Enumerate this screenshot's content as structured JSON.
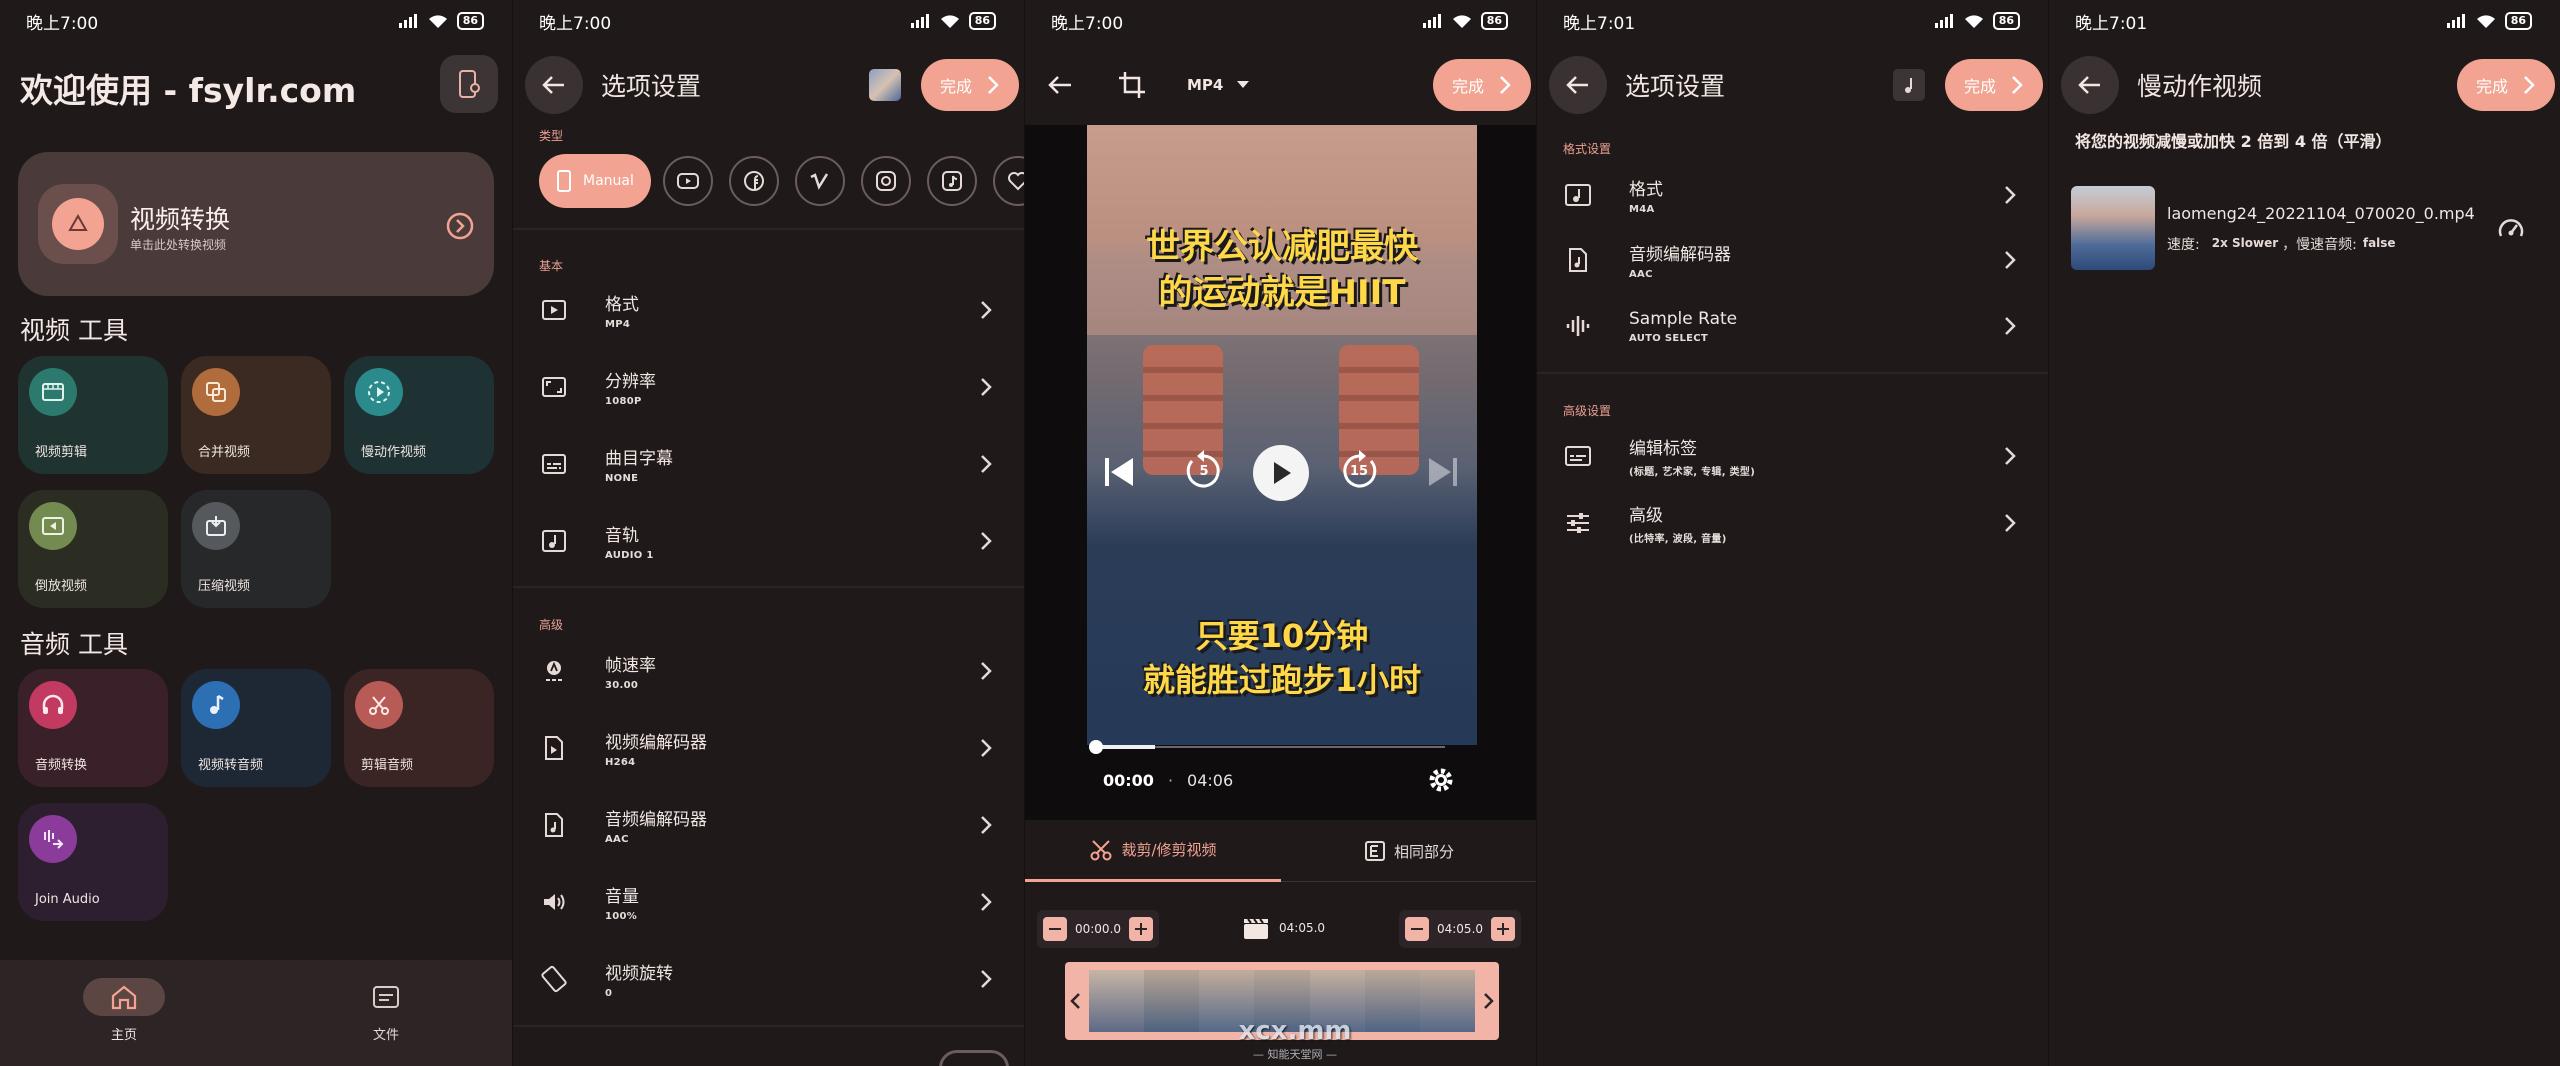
{
  "status": {
    "p1": "晚上7:00",
    "p2": "晚上7:00",
    "p3": "晚上7:00",
    "p4": "晚上7:01",
    "p5": "晚上7:01",
    "battery": "86"
  },
  "home": {
    "title": "欢迎使用 - fsylr.com",
    "hero_title": "视频转换",
    "hero_sub": "单击此处转换视频",
    "video_tools": "视频 工具",
    "audio_tools": "音频 工具",
    "video_items": [
      "视频剪辑",
      "合并视频",
      "慢动作视频",
      "倒放视频",
      "压缩视频"
    ],
    "audio_items": [
      "音频转换",
      "视频转音频",
      "剪辑音频",
      "Join Audio"
    ],
    "nav_home": "主页",
    "nav_files": "文件"
  },
  "options": {
    "title": "选项设置",
    "done": "完成",
    "type_label": "类型",
    "chip_manual": "Manual",
    "basic_label": "基本",
    "advanced_label": "高级",
    "rows": [
      {
        "label": "格式",
        "value": "MP4"
      },
      {
        "label": "分辨率",
        "value": "1080P"
      },
      {
        "label": "曲目字幕",
        "value": "NONE"
      },
      {
        "label": "音轨",
        "value": "AUDIO 1"
      },
      {
        "label": "帧速率",
        "value": "30.00"
      },
      {
        "label": "视频编解码器",
        "value": "H264"
      },
      {
        "label": "音频编解码器",
        "value": "AAC"
      },
      {
        "label": "音量",
        "value": "100%"
      },
      {
        "label": "视频旋转",
        "value": "0"
      }
    ]
  },
  "editor": {
    "format": "MP4",
    "done": "完成",
    "caption_top_1": "世界公认减肥最快",
    "caption_top_2": "的运动就是HIIT",
    "caption_bottom_1": "只要10分钟",
    "caption_bottom_2": "就能胜过跑步1小时",
    "rewind_seconds": "5",
    "forward_seconds": "15",
    "time_current": "00:00",
    "time_dot": "·",
    "time_total": "04:06",
    "tab_trim": "裁剪/修剪视频",
    "tab_same": "相同部分",
    "start_time": "00:00.0",
    "clip_duration": "04:05.0",
    "end_time": "04:05.0",
    "progress": 0.17,
    "watermark_text": "xcx.mm",
    "watermark_sub": "— 知能天堂网 —"
  },
  "audio_options": {
    "title": "选项设置",
    "done": "完成",
    "format_section": "格式设置",
    "advanced_section": "高级设置",
    "rows": [
      {
        "label": "格式",
        "value": "M4A"
      },
      {
        "label": "音频编解码器",
        "value": "AAC"
      },
      {
        "label": "Sample Rate",
        "value": "AUTO SELECT"
      },
      {
        "label": "编辑标签",
        "value": "(标题, 艺术家, 专辑, 类型)"
      },
      {
        "label": "高级",
        "value": "(比特率, 波段, 音量)"
      }
    ]
  },
  "slowmo": {
    "title": "慢动作视频",
    "done": "完成",
    "desc": "将您的视频减慢或加快 2 倍到 4 倍（平滑）",
    "file_name": "laomeng24_20221104_070020_0.mp4",
    "speed_label": "速度:",
    "speed_value": "2x Slower",
    "audio_label": "，慢速音频:",
    "audio_value": "false"
  },
  "colors": {
    "accent": "#f2a392",
    "background": "#1f191a"
  }
}
